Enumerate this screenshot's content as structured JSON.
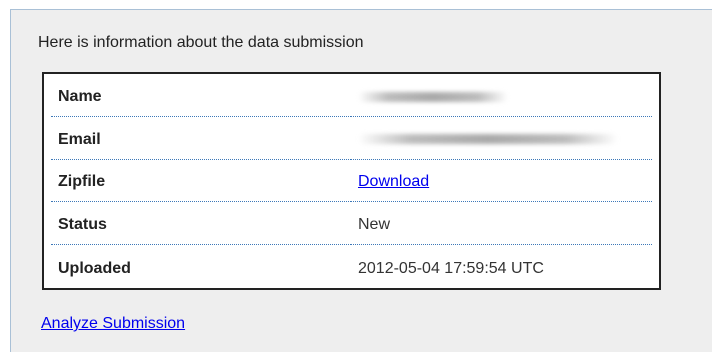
{
  "intro": "Here is information about the data submission",
  "rows": [
    {
      "label": "Name",
      "value": ""
    },
    {
      "label": "Email",
      "value": ""
    },
    {
      "label": "Zipfile",
      "value": "Download"
    },
    {
      "label": "Status",
      "value": "New"
    },
    {
      "label": "Uploaded",
      "value": "2012-05-04 17:59:54 UTC"
    }
  ],
  "analyze_link": "Analyze Submission",
  "colors": {
    "panel_bg": "#eeeeee",
    "link": "#0000ee",
    "row_divider": "#3d78b8"
  }
}
